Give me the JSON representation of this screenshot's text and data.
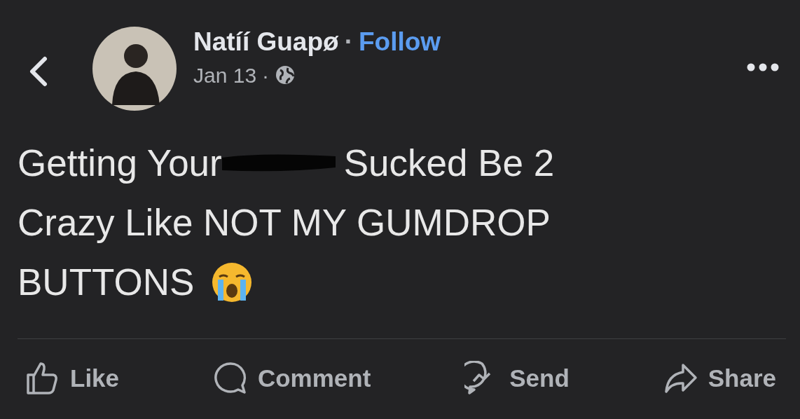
{
  "author": {
    "name": "Natíí Guapø",
    "separator": "·",
    "follow": "Follow"
  },
  "meta": {
    "date": "Jan 13",
    "separator": "·"
  },
  "post": {
    "lines": [
      [
        {
          "kind": "text",
          "text": "Getting Your"
        },
        {
          "kind": "scribble"
        },
        {
          "kind": "text",
          "text": "Sucked Be 2"
        }
      ],
      [
        {
          "kind": "text",
          "text": "Crazy Like NOT MY GUMDROP"
        }
      ],
      [
        {
          "kind": "text",
          "text": "BUTTONS"
        },
        {
          "kind": "emoji"
        }
      ]
    ]
  },
  "actions": [
    {
      "kind": "like",
      "label": "Like"
    },
    {
      "kind": "comment",
      "label": "Comment"
    },
    {
      "kind": "send",
      "label": "Send"
    },
    {
      "kind": "share",
      "label": "Share"
    }
  ]
}
